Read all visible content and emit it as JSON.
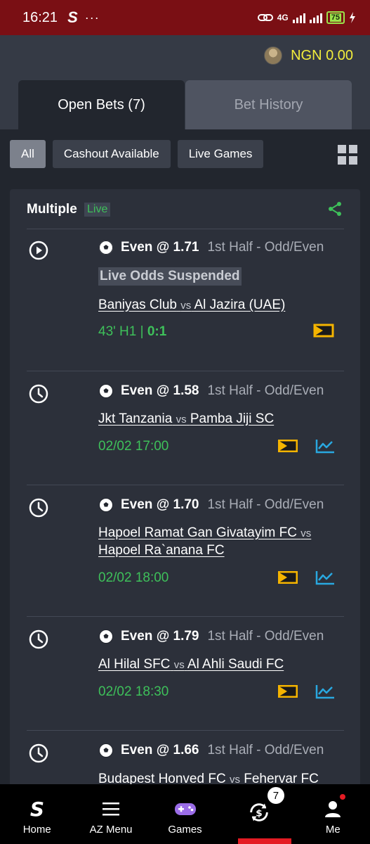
{
  "status_bar": {
    "time": "16:21",
    "logo": "S",
    "dots": "···",
    "network": "4G",
    "battery": "75"
  },
  "balance": {
    "text": "NGN 0.00"
  },
  "tabs": [
    {
      "label": "Open Bets (7)"
    },
    {
      "label": "Bet History"
    }
  ],
  "filters": [
    {
      "label": "All"
    },
    {
      "label": "Cashout Available"
    },
    {
      "label": "Live Games"
    }
  ],
  "bet": {
    "type": "Multiple",
    "live_badge": "Live",
    "selections": [
      {
        "pick": "Even @ 1.71",
        "market": "1st Half - Odd/Even",
        "suspended": "Live Odds Suspended",
        "home": "Baniyas Club",
        "vs": "vs",
        "away": "Al Jazira (UAE)",
        "status": "43' H1 | ",
        "score": "0:1"
      },
      {
        "pick": "Even @ 1.58",
        "market": "1st Half - Odd/Even",
        "home": "Jkt Tanzania",
        "vs": "vs",
        "away": "Pamba Jiji SC",
        "status": "02/02 17:00"
      },
      {
        "pick": "Even @ 1.70",
        "market": "1st Half - Odd/Even",
        "home": "Hapoel Ramat Gan Givatayim FC",
        "vs": "vs",
        "away": "Hapoel Ra`anana FC",
        "status": "02/02 18:00"
      },
      {
        "pick": "Even @ 1.79",
        "market": "1st Half - Odd/Even",
        "home": "Al Hilal SFC",
        "vs": "vs",
        "away": "Al Ahli Saudi FC",
        "status": "02/02 18:30"
      },
      {
        "pick": "Even @ 1.66",
        "market": "1st Half - Odd/Even",
        "home": "Budapest Honved FC",
        "vs": "vs",
        "away": "Fehervar FC"
      }
    ]
  },
  "bottom_nav": [
    {
      "label": "Home"
    },
    {
      "label": "AZ Menu"
    },
    {
      "label": "Games"
    },
    {
      "label": "",
      "badge": "7"
    },
    {
      "label": "Me"
    }
  ],
  "colors": {
    "status_bar": "#7a0f14",
    "accent_green": "#3ec05a",
    "balance_yellow": "#f3ee3c",
    "stream_orange": "#f5b400",
    "stats_blue": "#29a8e0",
    "active_red": "#e41b23"
  }
}
